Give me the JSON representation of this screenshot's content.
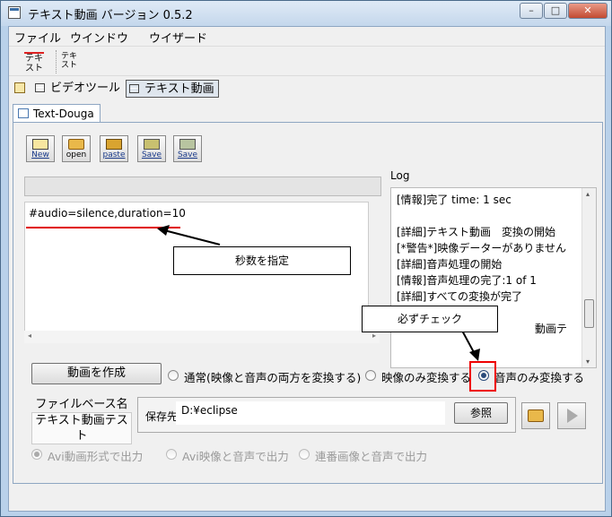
{
  "window": {
    "title": "テキスト動画 バージョン 0.5.2",
    "controls": {
      "minimize": "–",
      "maximize": "□",
      "close": "✕"
    }
  },
  "menu": [
    "ファイル",
    "ウインドウ",
    "ウイザード"
  ],
  "toolbar": {
    "icon1_label": "テキスト",
    "icon2_label": "テキスト"
  },
  "nav_tabs": {
    "video_tool": "ビデオツール",
    "text_video": "テキスト動画"
  },
  "doc_tab": "Text-Douga",
  "buttons": {
    "new": "New",
    "open": "open",
    "paste": "paste",
    "save1": "Save",
    "save2": "Save",
    "convert": "動画を作成",
    "browse": "参照"
  },
  "editor": {
    "line1": "#audio=silence,duration=10"
  },
  "annotations": {
    "seconds": "秒数を指定",
    "must_check": "必ずチェック"
  },
  "log": {
    "label": "Log",
    "lines": [
      "[情報]完了 time: 1 sec",
      "",
      "[詳細]テキスト動画　変換の開始",
      "[*警告*]映像データーがありません",
      "[詳細]音声処理の開始",
      "[情報]音声処理の完了:1 of 1",
      "[詳細]すべての変換が完了",
      "",
      "",
      "動画テ"
    ]
  },
  "convert_options": {
    "normal": "通常(映像と音声の両方を変換する)",
    "video_only": "映像のみ変換する",
    "audio_only": "音声のみ変換する",
    "selected": "audio_only"
  },
  "file": {
    "basename_label": "ファイルベース名",
    "basename_value": "テキスト動画テスト",
    "save_label": "保存先",
    "save_path": "D:¥eclipse"
  },
  "output_options": {
    "avi": "Avi動画形式で出力",
    "avi_av": "Avi映像と音声で出力",
    "sequence": "連番画像と音声で出力"
  },
  "colors": {
    "accent": "#2a4a7a",
    "highlight_red": "#e00000"
  }
}
